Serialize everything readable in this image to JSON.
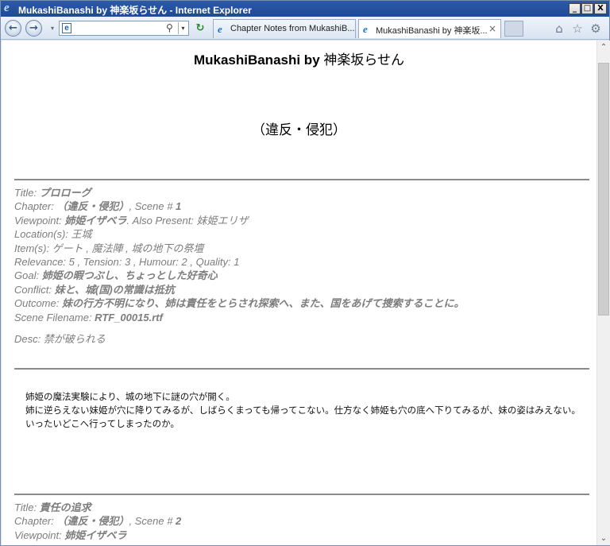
{
  "window": {
    "title": "MukashiBanashi by 神楽坂らせん - Internet Explorer",
    "minimize": "_",
    "maximize": "□",
    "close": "X"
  },
  "nav": {
    "back_glyph": "←",
    "forward_glyph": "→",
    "address_value": "",
    "page_icon_glyph": "e",
    "search_glyph": "⚲",
    "dropdown_glyph": "▾",
    "refresh_glyph": "↻"
  },
  "tabs": [
    {
      "label": "Chapter Notes from MukashiB...",
      "active": false
    },
    {
      "label": "MukashiBanashi by 神楽坂...",
      "active": true,
      "close": "×"
    }
  ],
  "toolbar": {
    "home_glyph": "⌂",
    "favorites_glyph": "☆",
    "settings_glyph": "⚙"
  },
  "page": {
    "title_latin": "MukashiBanashi by ",
    "title_jp": "神楽坂らせん",
    "chapter_heading": "（違反・侵犯）"
  },
  "scenes": [
    {
      "title_label": "Title: ",
      "title": "プロローグ",
      "chapter_label": "Chapter: ",
      "chapter": "（違反・侵犯）",
      "scene_label": ", Scene # ",
      "scene_no": "1",
      "viewpoint_label": "Viewpoint: ",
      "viewpoint": "姉姫イザベラ",
      "also_label": ". Also Present: ",
      "also": "妹姫エリザ",
      "location_label": "Location(s): ",
      "location": "王城",
      "items_label": "Item(s): ",
      "items": "ゲート , 魔法陣 , 城の地下の祭壇",
      "relevance_line": "Relevance: 5 , Tension: 3 , Humour: 2 , Quality: 1",
      "goal_label": "Goal: ",
      "goal": "姉姫の暇つぶし、ちょっとした好奇心",
      "conflict_label": "Conflict: ",
      "conflict": "妹と、城(国)の常識は抵抗",
      "outcome_label": "Outcome: ",
      "outcome": "妹の行方不明になり、姉は責任をとらされ探索へ、また、国をあげて捜索することに。",
      "filename_label": "Scene Filename: ",
      "filename": "RTF_00015.rtf",
      "desc_label": "Desc: ",
      "desc": "禁が破られる",
      "text": [
        "姉姫の魔法実験により、城の地下に謎の穴が開く。",
        "姉に逆らえない妹姫が穴に降りてみるが、しばらくまっても帰ってこない。仕方なく姉姫も穴の底へ下りてみるが、妹の姿はみえない。",
        "いったいどこへ行ってしまったのか。"
      ]
    },
    {
      "title_label": "Title: ",
      "title": "責任の追求",
      "chapter_label": "Chapter: ",
      "chapter": "（違反・侵犯）",
      "scene_label": ", Scene # ",
      "scene_no": "2",
      "viewpoint_label": "Viewpoint: ",
      "viewpoint": "姉姫イザベラ"
    }
  ],
  "scrollbar": {
    "up_glyph": "⌃",
    "down_glyph": "⌄"
  }
}
